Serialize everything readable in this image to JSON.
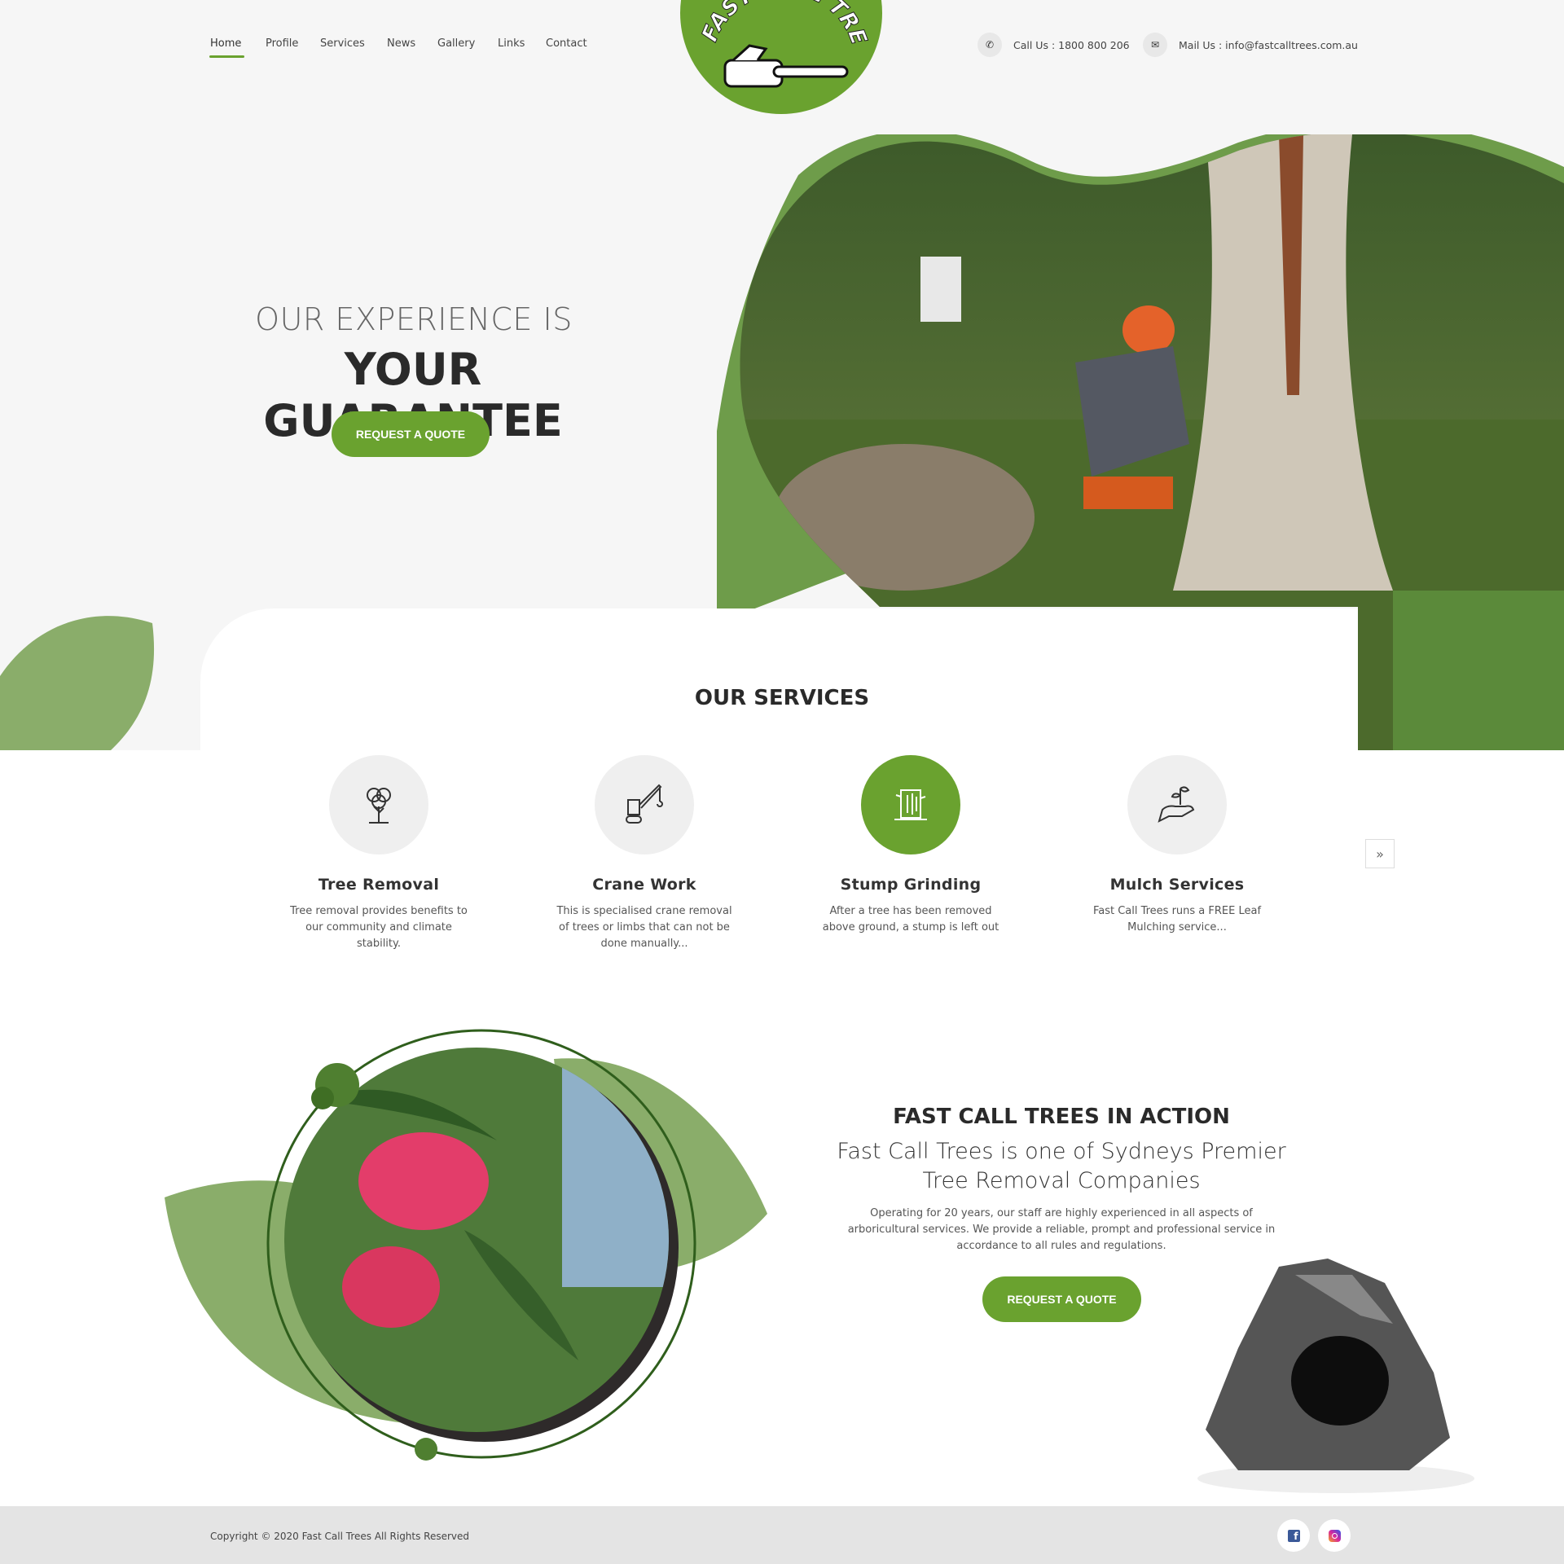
{
  "nav": {
    "items": [
      {
        "label": "Home",
        "active": true
      },
      {
        "label": "Profile"
      },
      {
        "label": "Services"
      },
      {
        "label": "News"
      },
      {
        "label": "Gallery"
      },
      {
        "label": "Links"
      },
      {
        "label": "Contact"
      }
    ]
  },
  "logo": {
    "text": "FAST CALL TREES",
    "icon": "chainsaw-icon",
    "color": "#6aa22f"
  },
  "contact": {
    "phone": "Call Us : 1800 800 206",
    "email": "Mail Us : info@fastcalltrees.com.au"
  },
  "hero": {
    "line1": "OUR EXPERIENCE IS",
    "line2": "YOUR GUARANTEE",
    "button": "REQUEST A QUOTE"
  },
  "services": {
    "title": "OUR SERVICES",
    "items": [
      {
        "title": "Tree Removal",
        "desc": "Tree removal provides benefits to our community and climate stability.",
        "icon": "tree-icon"
      },
      {
        "title": "Crane Work",
        "desc": "This is specialised crane removal of trees or limbs that can not be done manually...",
        "icon": "crane-icon"
      },
      {
        "title": "Stump Grinding",
        "desc": "After a tree has been removed above ground, a stump is left out",
        "icon": "stump-icon",
        "active": true
      },
      {
        "title": "Mulch Services",
        "desc": "Fast Call Trees runs a FREE Leaf Mulching service...",
        "icon": "plant-hand-icon"
      }
    ],
    "next_icon": "double-chevron-right-icon"
  },
  "action": {
    "title": "FAST CALL TREES IN ACTION",
    "subtitle": "Fast Call Trees is one of Sydneys Premier Tree Removal Companies",
    "body": "Operating for 20 years, our staff are highly experienced in all aspects of arboricultural services. We provide a reliable, prompt and professional service in accordance to all rules and regulations.",
    "button": "REQUEST A QUOTE"
  },
  "footer": {
    "copyright": "Copyright © 2020 Fast Call Trees All Rights Reserved",
    "social": [
      "facebook-icon",
      "instagram-icon"
    ]
  },
  "colors": {
    "accent": "#6aa22f",
    "leaf": "#8aad6a",
    "footer": "#e4e4e4"
  }
}
